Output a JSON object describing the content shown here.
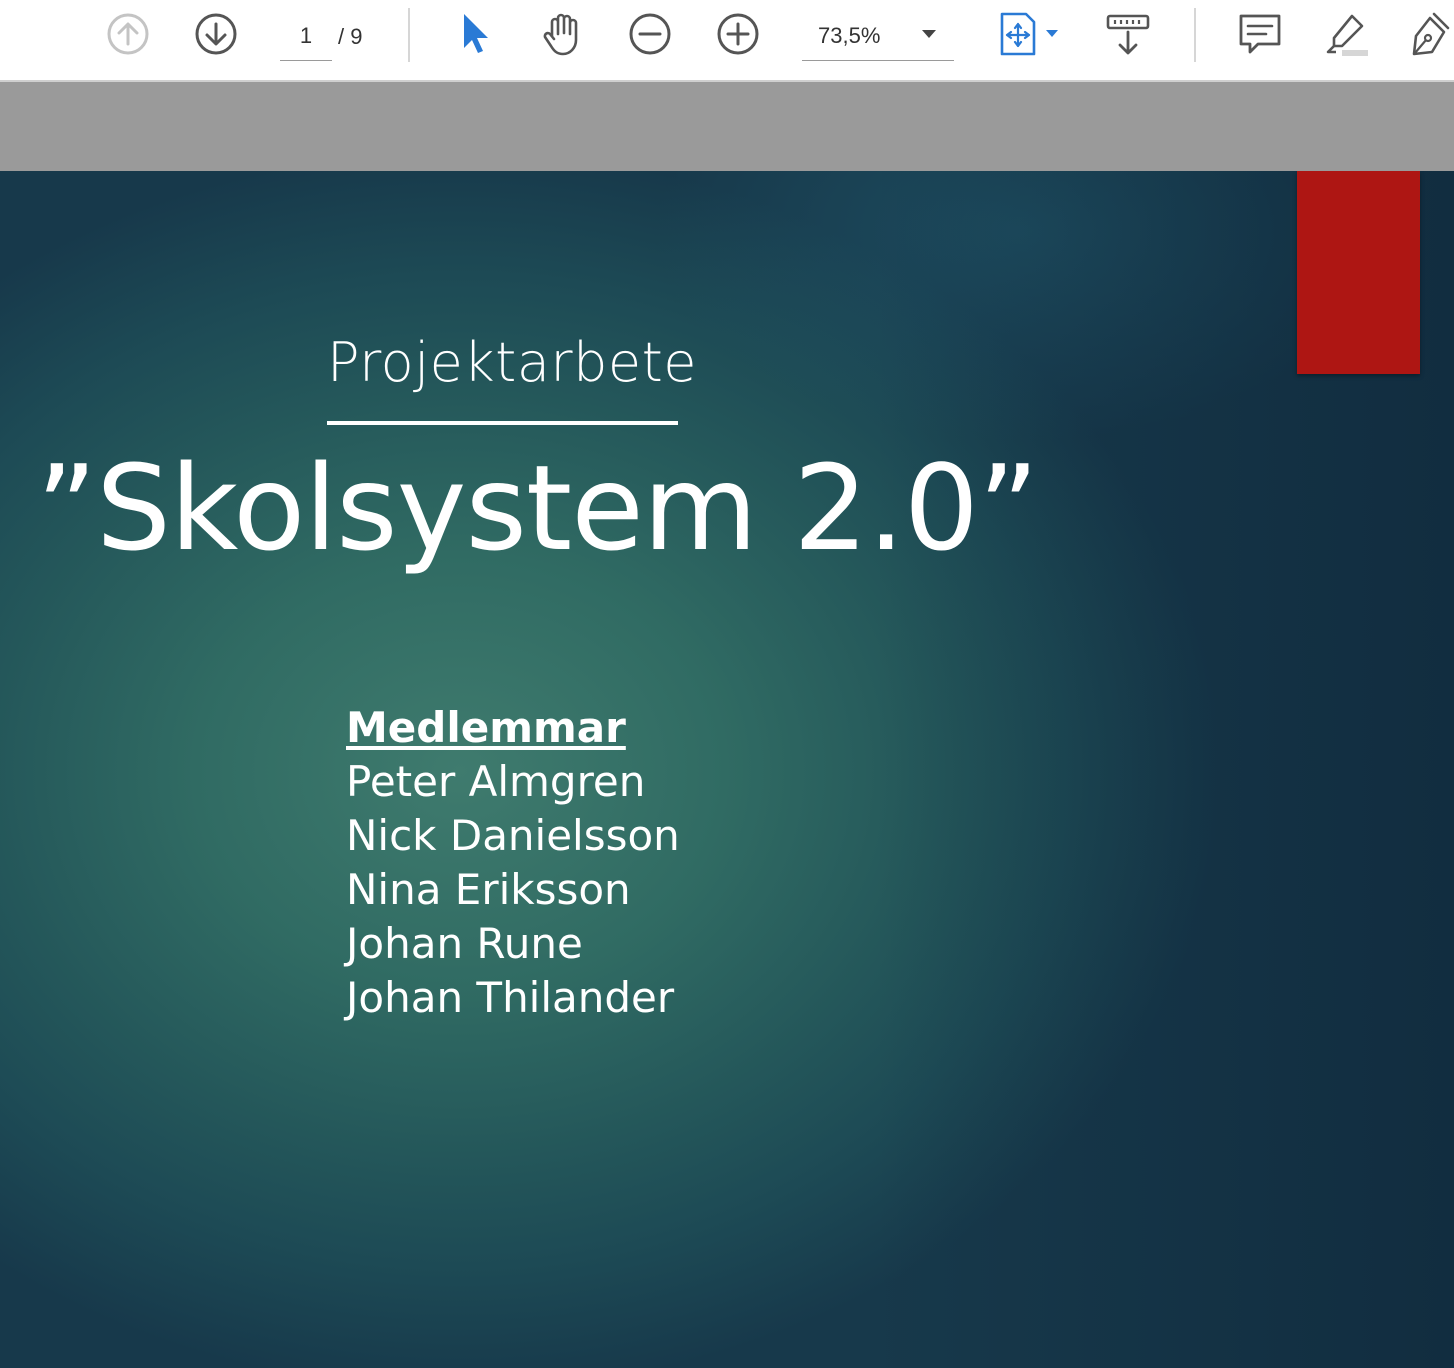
{
  "toolbar": {
    "prev_page_icon": "arrow-up-circle-icon",
    "next_page_icon": "arrow-down-circle-icon",
    "current_page": "1",
    "total_pages": "/ 9",
    "select_tool_icon": "cursor-arrow-icon",
    "hand_tool_icon": "hand-icon",
    "zoom_out_icon": "minus-circle-icon",
    "zoom_in_icon": "plus-circle-icon",
    "zoom_level": "73,5%",
    "fit_page_icon": "fit-page-icon",
    "scroll_mode_icon": "scroll-mode-icon",
    "comment_icon": "comment-icon",
    "highlight_icon": "highlighter-icon",
    "sign_icon": "pen-sign-icon",
    "accent_color": "#2a7ad5"
  },
  "slide": {
    "subtitle": "Projektarbete",
    "title": "”Skolsystem 2.0”",
    "members_heading": "Medlemmar",
    "members": [
      "Peter Almgren",
      "Nick Danielsson",
      "Nina Eriksson",
      "Johan Rune",
      "Johan Thilander"
    ],
    "accent_tab_color": "#ae1613",
    "background_color": "#2d6560"
  }
}
